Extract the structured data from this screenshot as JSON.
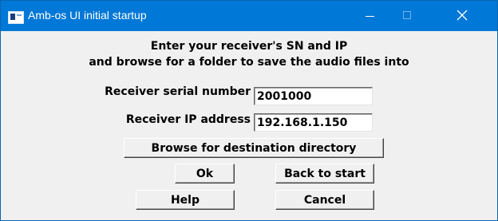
{
  "window": {
    "title": "Amb-os UI initial startup",
    "accent_color": "#0078d7",
    "controls": {
      "minimize_icon": "minimize-icon",
      "maximize_icon": "maximize-icon",
      "close_icon": "close-icon"
    }
  },
  "dialog": {
    "instruction_line1": "Enter your receiver's SN and IP",
    "instruction_line2": "and browse for a folder to save the audio files into",
    "serial_label": "Receiver serial number",
    "serial_value": "2001000",
    "ip_label": "Receiver IP address",
    "ip_value": "192.168.1.150",
    "browse_button": "Browse for destination directory",
    "ok_button": "Ok",
    "back_button": "Back to start",
    "help_button": "Help",
    "cancel_button": "Cancel"
  }
}
